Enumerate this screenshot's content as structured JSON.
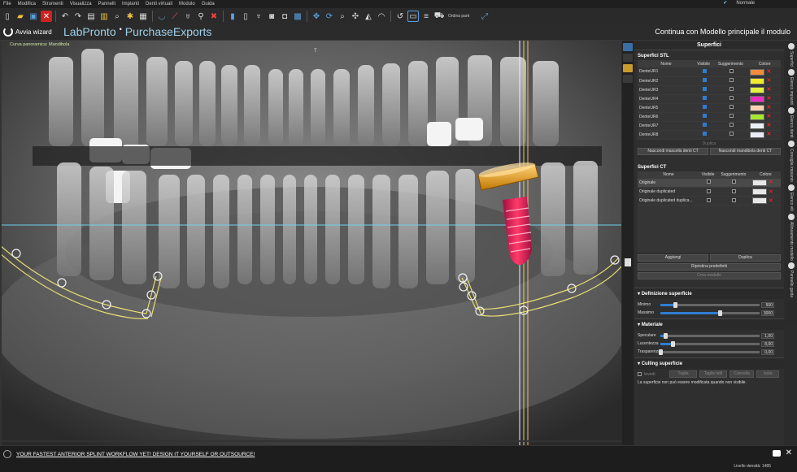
{
  "menu": [
    "File",
    "Modifica",
    "Strumenti",
    "Visualizza",
    "Pannelli",
    "Impianti",
    "Denti virtuali",
    "Modulo",
    "Guida"
  ],
  "menu_right": "Normale",
  "toolbar": {
    "ordina": "Ordina parti"
  },
  "header": {
    "wizard": "Avvia wizard",
    "brand1": "LabPronto",
    "brand2": "PurchaseExports",
    "continua": "Continua con Modello principale il modulo"
  },
  "viewport": {
    "label": "Curva panoramica: Mandibola",
    "marker": "T"
  },
  "panel": {
    "title": "Superfici",
    "stl": {
      "heading": "Superfici STL",
      "cols": [
        "Nome",
        "Visibile",
        "Suggerimento",
        "Colore"
      ],
      "rows": [
        {
          "name": "DenteUR1",
          "visible": true,
          "color": "#f28c3c"
        },
        {
          "name": "DenteUR2",
          "visible": true,
          "color": "#f2ea2c"
        },
        {
          "name": "DenteUR3",
          "visible": true,
          "color": "#e2f23c"
        },
        {
          "name": "DenteUR4",
          "visible": true,
          "color": "#ee2cc4"
        },
        {
          "name": "DenteUR5",
          "visible": true,
          "color": "#f6d2b0"
        },
        {
          "name": "DenteUR6",
          "visible": true,
          "color": "#a8e82c"
        },
        {
          "name": "DenteUR7",
          "visible": true,
          "color": "#e8f0f6"
        },
        {
          "name": "DenteUR8",
          "visible": true,
          "color": "#eaeaf8"
        }
      ],
      "duplica": "Duplica",
      "hide_upper": "Nascondi mascella denti CT",
      "hide_lower": "Nascondi mandibola denti CT"
    },
    "ct": {
      "heading": "Superfici CT",
      "cols": [
        "Nome",
        "Visibile",
        "Suggerimento",
        "Colore"
      ],
      "rows": [
        {
          "name": "Originale"
        },
        {
          "name": "Originale duplicated"
        },
        {
          "name": "Originale duplicated duplica..."
        }
      ],
      "aggiungi": "Aggiungi",
      "duplica": "Duplica",
      "ripristina": "Ripristina predefiniti",
      "crea": "Crea modello"
    },
    "definizione": {
      "heading": "Definizione superficie",
      "min_label": "Minimo",
      "min_val": "500",
      "max_label": "Massimo",
      "max_val": "3000",
      "min_frac": 0.15,
      "max_frac": 0.6
    },
    "materiale": {
      "heading": "Materiale",
      "rows": [
        {
          "label": "Speculare",
          "value": "1,00",
          "frac": 0.05
        },
        {
          "label": "Lucentezza",
          "value": "8,00",
          "frac": 0.12
        },
        {
          "label": "Trasparenza",
          "value": "0,00",
          "frac": 0.0
        }
      ]
    },
    "culling": {
      "heading": "Culling superficie",
      "inverti": "Inverti",
      "taglia": "Taglia",
      "taglia_tutti": "Taglia tutti",
      "cancella": "Cancella",
      "isola": "Isola",
      "note": "La superficie non può essere modificata quando non visibile."
    }
  },
  "vtabs": [
    "Superfici",
    "Elenco impianti",
    "Elenco denti",
    "Consiglia impianto",
    "Elenco viti",
    "Allineamento modello",
    "Pannello guida"
  ],
  "status": {
    "banner": "YOUR FASTEST ANTERIOR SPLINT WORKFLOW YET! DESIGN IT YOURSELF OR OUTSOURCE!",
    "density": "Livello densità: 1485"
  }
}
